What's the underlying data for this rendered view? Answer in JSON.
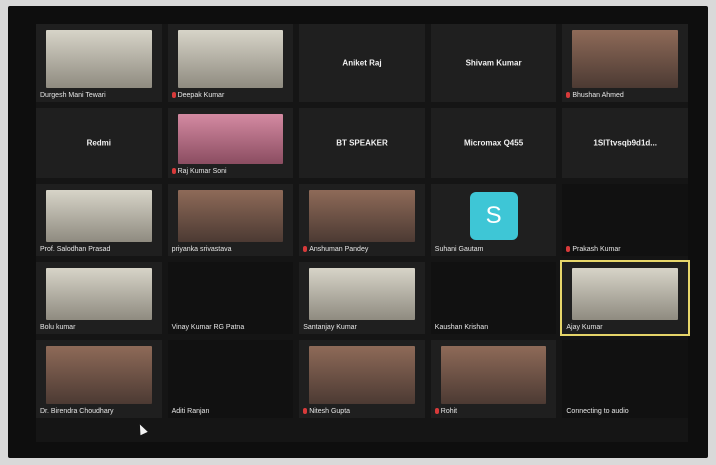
{
  "participants": [
    {
      "row": 1,
      "name": "Durgesh Mani Tewari",
      "muted": false,
      "type": "video",
      "variant": "light"
    },
    {
      "row": 1,
      "name": "Deepak Kumar",
      "muted": true,
      "type": "video",
      "variant": "light"
    },
    {
      "row": 1,
      "name": "Aniket Raj",
      "muted": false,
      "type": "center"
    },
    {
      "row": 1,
      "name": "Shivam Kumar",
      "muted": false,
      "type": "center"
    },
    {
      "row": 1,
      "name": "Bhushan Ahmed",
      "muted": true,
      "type": "video",
      "variant": "warm"
    },
    {
      "row": 2,
      "name": "Redmi",
      "muted": false,
      "type": "center"
    },
    {
      "row": 2,
      "name": "Raj Kumar Soni",
      "muted": true,
      "type": "video",
      "variant": "pink"
    },
    {
      "row": 2,
      "name": "BT SPEAKER",
      "muted": false,
      "type": "center"
    },
    {
      "row": 2,
      "name": "Micromax Q455",
      "muted": true,
      "type": "center"
    },
    {
      "row": 2,
      "name": "1SlTtvsqb9d1d...",
      "muted": true,
      "type": "center"
    },
    {
      "row": 3,
      "name": "Prof. Salodhan Prasad",
      "muted": false,
      "type": "video",
      "variant": "light"
    },
    {
      "row": 3,
      "name": "priyanka srivastava",
      "muted": false,
      "type": "video",
      "variant": "warm"
    },
    {
      "row": 3,
      "name": "Anshuman Pandey",
      "muted": true,
      "type": "video",
      "variant": "warm"
    },
    {
      "row": 3,
      "name": "Suhani Gautam",
      "muted": false,
      "type": "avatar",
      "avatar_letter": "S"
    },
    {
      "row": 3,
      "name": "Prakash Kumar",
      "muted": true,
      "type": "plain"
    },
    {
      "row": 4,
      "name": "Bolu kumar",
      "muted": false,
      "type": "video",
      "variant": "light"
    },
    {
      "row": 4,
      "name": "Vinay Kumar RG Patna",
      "muted": false,
      "type": "plain"
    },
    {
      "row": 4,
      "name": "Santanjay Kumar",
      "muted": false,
      "type": "video",
      "variant": "light"
    },
    {
      "row": 4,
      "name": "Kaushan Krishan",
      "muted": false,
      "type": "plain"
    },
    {
      "row": 4,
      "name": "Ajay Kumar",
      "muted": false,
      "type": "video",
      "variant": "light",
      "active": true
    },
    {
      "row": 5,
      "name": "Dr. Birendra Choudhary",
      "muted": false,
      "type": "video",
      "variant": "warm"
    },
    {
      "row": 5,
      "name": "Aditi Ranjan",
      "muted": false,
      "type": "plain"
    },
    {
      "row": 5,
      "name": "Nitesh Gupta",
      "muted": true,
      "type": "video",
      "variant": "warm"
    },
    {
      "row": 5,
      "name": "Rohit",
      "muted": true,
      "type": "video",
      "variant": "warm"
    },
    {
      "row": 5,
      "name": "Connecting to audio",
      "muted": false,
      "type": "status"
    }
  ]
}
